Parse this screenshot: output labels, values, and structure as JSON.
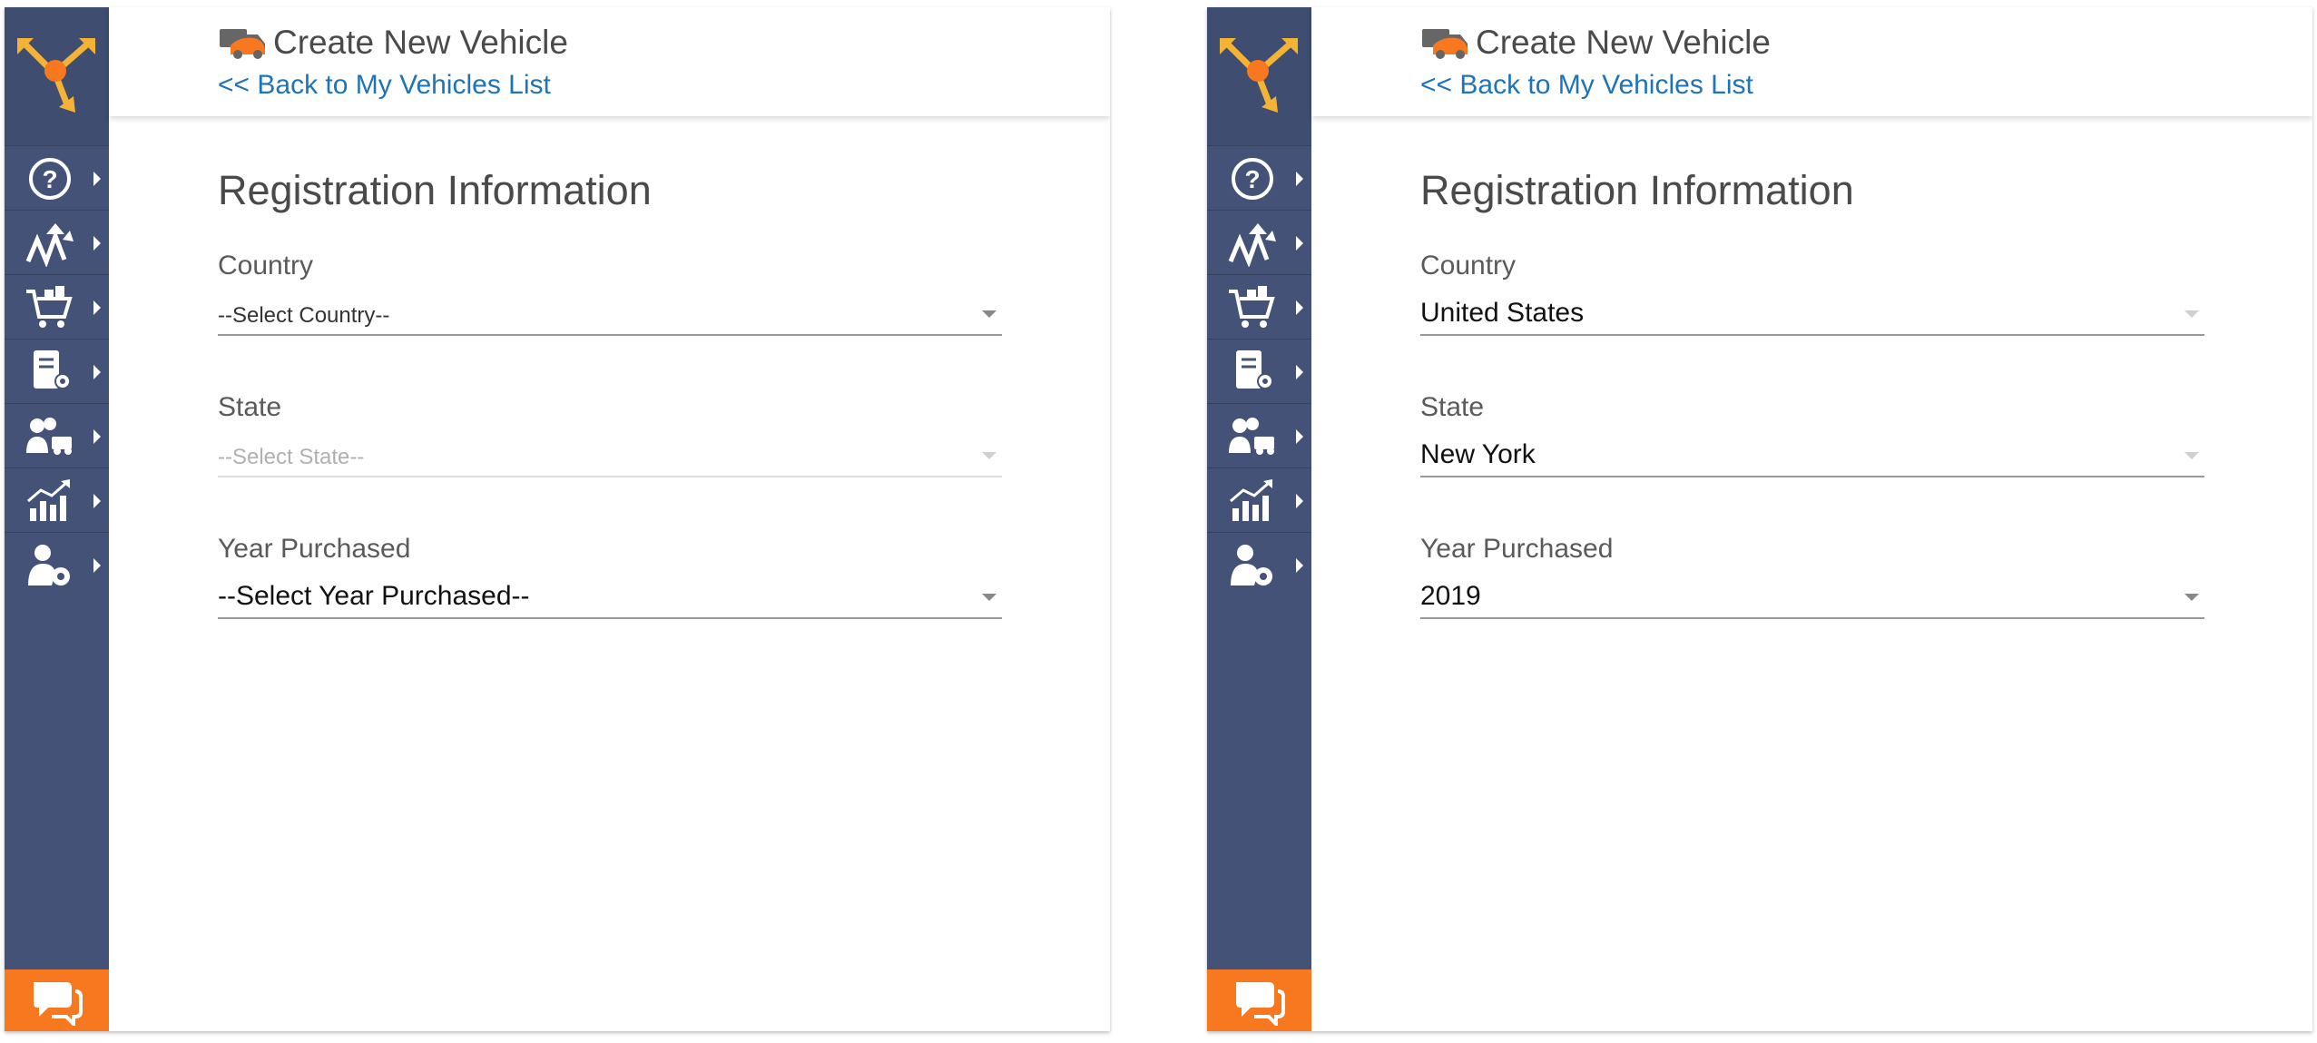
{
  "colors": {
    "sidebar": "#435276",
    "accent_orange": "#f7781f",
    "link_blue": "#1f73b7",
    "title_gray": "#4a4a4a"
  },
  "sidebar": {
    "logo_icon": "route4me-logo-icon",
    "items": [
      {
        "icon": "help-icon"
      },
      {
        "icon": "route-optimize-icon"
      },
      {
        "icon": "shopping-cart-icon"
      },
      {
        "icon": "address-book-icon"
      },
      {
        "icon": "team-vehicle-icon"
      },
      {
        "icon": "analytics-chart-icon"
      },
      {
        "icon": "user-settings-icon"
      }
    ],
    "chat_icon": "chat-icon"
  },
  "panels": [
    {
      "header": {
        "title": "Create New Vehicle",
        "back_link": "<< Back to My Vehicles List"
      },
      "section_title": "Registration Information",
      "fields": {
        "country": {
          "label": "Country",
          "value": "--Select Country--"
        },
        "state": {
          "label": "State",
          "value": "--Select State--"
        },
        "year": {
          "label": "Year Purchased",
          "value": "--Select Year Purchased--"
        }
      }
    },
    {
      "header": {
        "title": "Create New Vehicle",
        "back_link": "<< Back to My Vehicles List"
      },
      "section_title": "Registration Information",
      "fields": {
        "country": {
          "label": "Country",
          "value": "United States"
        },
        "state": {
          "label": "State",
          "value": "New York"
        },
        "year": {
          "label": "Year Purchased",
          "value": "2019"
        }
      }
    }
  ]
}
